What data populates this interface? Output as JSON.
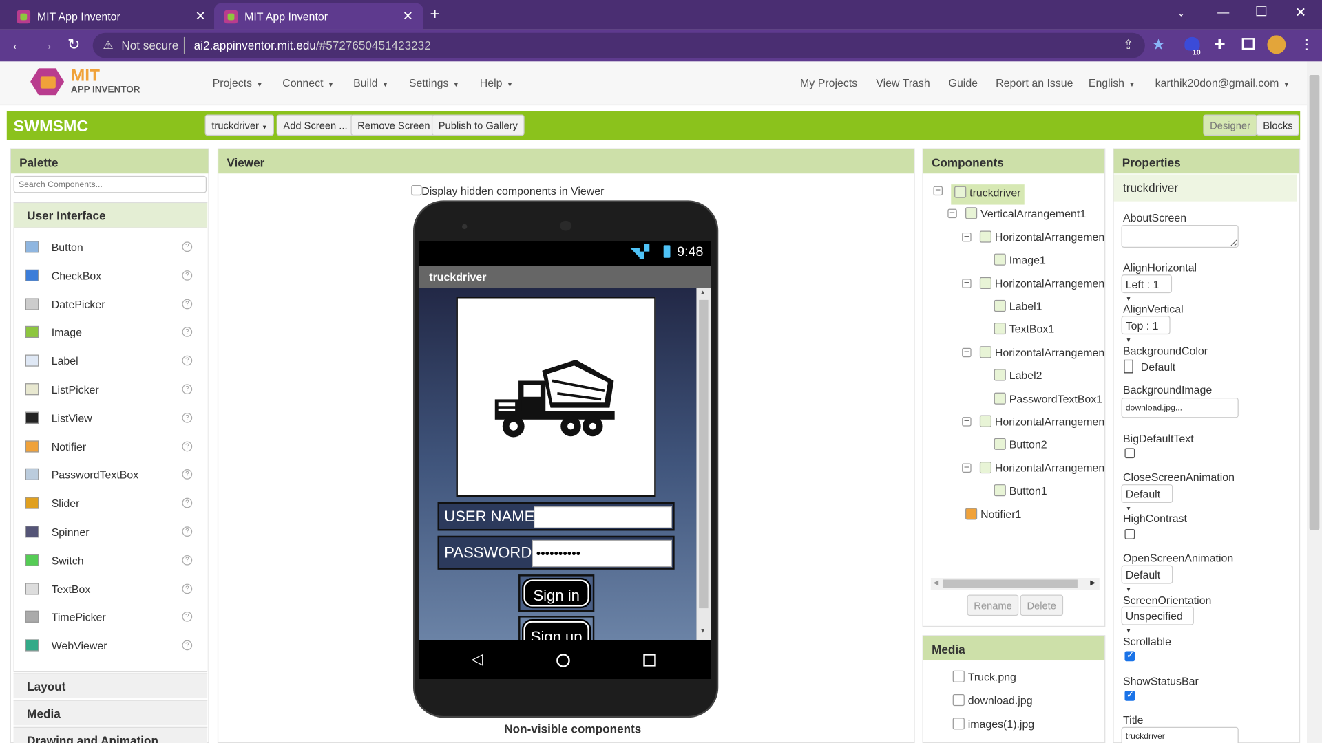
{
  "browser": {
    "tabs": [
      {
        "title": "MIT App Inventor"
      },
      {
        "title": "MIT App Inventor"
      }
    ],
    "security_label": "Not secure",
    "url_host": "ai2.appinventor.mit.edu",
    "url_path": "/#5727650451423232",
    "extension_badge": "10"
  },
  "app": {
    "logo_line1": "MIT",
    "logo_line2": "APP INVENTOR",
    "menus": [
      "Projects",
      "Connect",
      "Build",
      "Settings",
      "Help"
    ],
    "right_links": [
      "My Projects",
      "View Trash",
      "Guide",
      "Report an Issue",
      "English"
    ],
    "account": "karthik20don@gmail.com"
  },
  "toolbar": {
    "project_name": "SWMSMC",
    "screen_select": "truckdriver",
    "add_screen": "Add Screen ...",
    "remove_screen": "Remove Screen",
    "publish": "Publish to Gallery",
    "designer": "Designer",
    "blocks": "Blocks"
  },
  "palette": {
    "title": "Palette",
    "search_placeholder": "Search Components...",
    "category_open": "User Interface",
    "items": [
      "Button",
      "CheckBox",
      "DatePicker",
      "Image",
      "Label",
      "ListPicker",
      "ListView",
      "Notifier",
      "PasswordTextBox",
      "Slider",
      "Spinner",
      "Switch",
      "TextBox",
      "TimePicker",
      "WebViewer"
    ],
    "categories_closed": [
      "Layout",
      "Media",
      "Drawing and Animation"
    ]
  },
  "viewer": {
    "title": "Viewer",
    "hidden_checkbox_label": "Display hidden components in Viewer",
    "phone_time": "9:48",
    "screen_title": "truckdriver",
    "username_label": "USER NAME",
    "password_label": "PASSWORD",
    "password_value": "••••••••••",
    "signin": "Sign in",
    "signup": "Sign up",
    "nonvisible": "Non-visible components"
  },
  "components": {
    "title": "Components",
    "tree": [
      "truckdriver",
      "VerticalArrangement1",
      "HorizontalArrangemen",
      "Image1",
      "HorizontalArrangemen",
      "Label1",
      "TextBox1",
      "HorizontalArrangemen",
      "Label2",
      "PasswordTextBox1",
      "HorizontalArrangemen",
      "Button2",
      "HorizontalArrangemen",
      "Button1",
      "Notifier1"
    ],
    "rename": "Rename",
    "delete": "Delete"
  },
  "media": {
    "title": "Media",
    "files": [
      "Truck.png",
      "download.jpg",
      "images(1).jpg"
    ]
  },
  "properties": {
    "title": "Properties",
    "component": "truckdriver",
    "about_screen": "AboutScreen",
    "align_horizontal": "AlignHorizontal",
    "align_horizontal_value": "Left : 1",
    "align_vertical": "AlignVertical",
    "align_vertical_value": "Top : 1",
    "background_color": "BackgroundColor",
    "background_color_value": "Default",
    "background_image": "BackgroundImage",
    "background_image_value": "download.jpg...",
    "big_default_text": "BigDefaultText",
    "close_anim": "CloseScreenAnimation",
    "close_anim_value": "Default",
    "high_contrast": "HighContrast",
    "open_anim": "OpenScreenAnimation",
    "open_anim_value": "Default",
    "orientation": "ScreenOrientation",
    "orientation_value": "Unspecified",
    "scrollable": "Scrollable",
    "show_status_bar": "ShowStatusBar",
    "title_label": "Title",
    "title_value": "truckdriver"
  }
}
